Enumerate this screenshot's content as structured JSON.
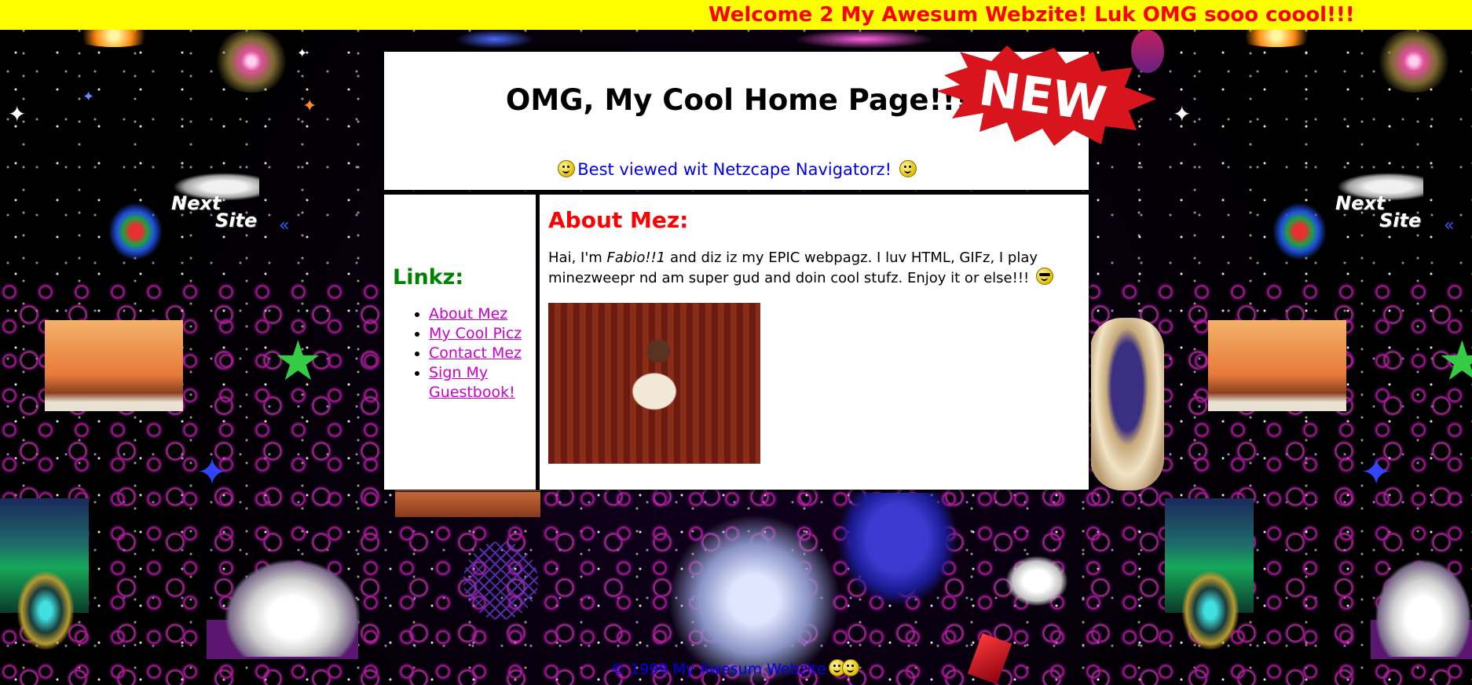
{
  "marquee": {
    "text": "Welcome 2 My Awesum Webzite! Luk OMG sooo coool!!!"
  },
  "header": {
    "title": "OMG, My Cool Home Page!!!",
    "best_viewed": "Best viewed wit Netzcape Navigatorz!",
    "badge": "NEW"
  },
  "sidebar": {
    "heading": "Linkz:",
    "links": [
      {
        "label": "About Mez"
      },
      {
        "label": "My Cool Picz"
      },
      {
        "label": "Contact Mez"
      },
      {
        "label": "Sign My Guestbook!"
      }
    ]
  },
  "content": {
    "heading": "About Mez:",
    "intro": "Hai, I'm ",
    "name": "Fabio!!1",
    "body": " and diz iz my EPIC webpagz. I luv HTML, GIFz, I play minezweepr nd am super gud and doin cool stufz. Enjoy it or else!!!"
  },
  "decorations": {
    "next_site_line1": "Next",
    "next_site_line2": "Site"
  },
  "footer": {
    "text": "© 1999 My Awesum Webzite"
  },
  "colors": {
    "marquee_bg": "#ffff00",
    "marquee_text": "#ff0000",
    "links_heading": "#008000",
    "about_heading": "#ff0000",
    "link": "#cc00cc",
    "best_viewed": "#0000ee"
  }
}
